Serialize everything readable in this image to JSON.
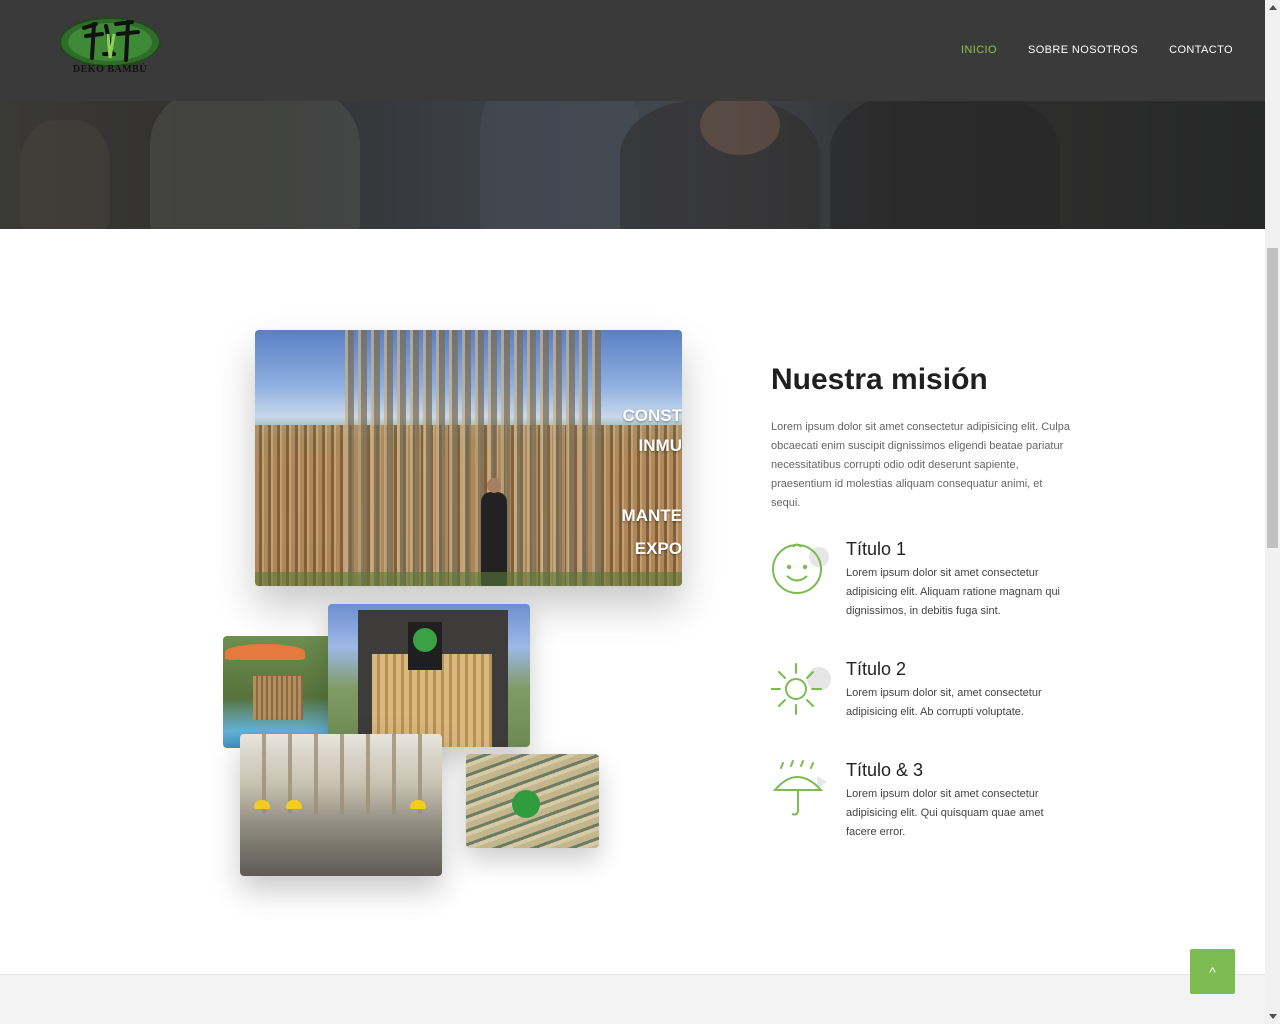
{
  "brand": {
    "name": "DEKO BAMBÚ",
    "accent_color": "#8cc152"
  },
  "nav": {
    "items": [
      {
        "label": "INICIO",
        "active": true
      },
      {
        "label": "SOBRE NOSOTROS",
        "active": false
      },
      {
        "label": "CONTACTO",
        "active": false
      }
    ]
  },
  "gallery": {
    "caption_lines": [
      "CONST",
      "INMU",
      "MANTE",
      "EXPO"
    ]
  },
  "mission": {
    "title": "Nuestra misión",
    "text": "Lorem ipsum dolor sit amet consectetur adipisicing elit. Culpa obcaecati enim suscipit dignissimos eligendi beatae pariatur necessitatibus corrupti odio odit deserunt sapiente, praesentium id molestias aliquam consequatur animi, et sequi.",
    "features": [
      {
        "icon": "baby-face-icon",
        "title": "Título 1",
        "text": "Lorem ipsum dolor sit amet consectetur adipisicing elit. Aliquam ratione magnam qui dignissimos, in debitis fuga sint."
      },
      {
        "icon": "sun-icon",
        "title": "Título 2",
        "text": "Lorem ipsum dolor sit, amet consectetur adipisicing elit. Ab corrupti voluptate."
      },
      {
        "icon": "umbrella-rain-icon",
        "title": "Título & 3",
        "text": "Lorem ipsum dolor sit amet consectetur adipisicing elit. Qui quisquam quae amet facere error."
      }
    ]
  },
  "back_to_top": {
    "icon": "chevron-up-icon",
    "glyph": "^",
    "color": "#7cbb4f"
  }
}
